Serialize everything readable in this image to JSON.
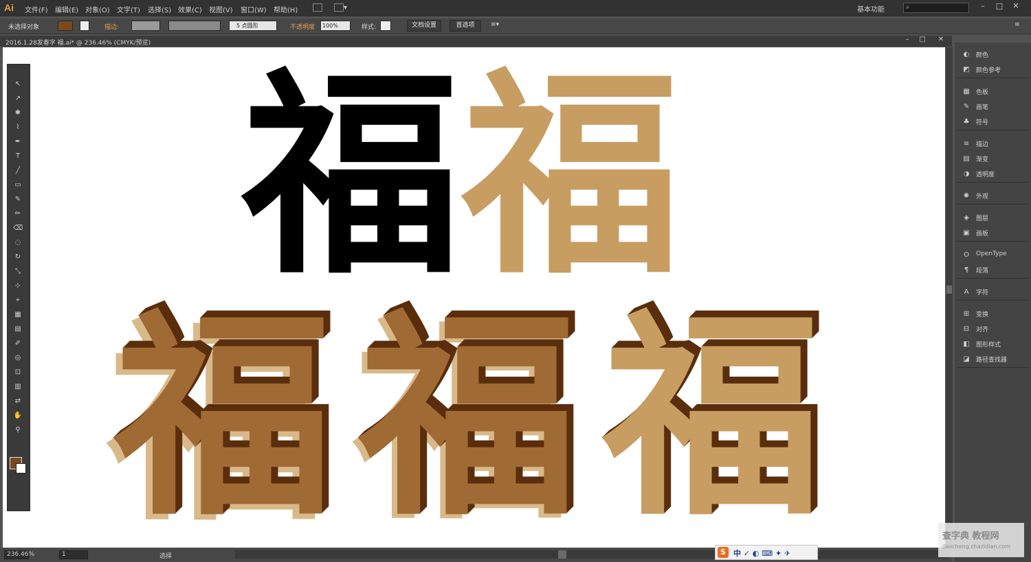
{
  "app": {
    "logo": "Ai",
    "workspace": "基本功能"
  },
  "menu": [
    "文件(F)",
    "编辑(E)",
    "对象(O)",
    "文字(T)",
    "选择(S)",
    "效果(C)",
    "视图(V)",
    "窗口(W)",
    "帮助(H)"
  ],
  "control_bar": {
    "selection_status": "未选择对象",
    "stroke_label": "描边:",
    "brush_value": "5 点圆形",
    "opacity_label": "不透明度",
    "opacity_value": "100%",
    "style_label": "样式:",
    "doc_setup_button": "文档设置",
    "preferences_button": "首选项"
  },
  "document": {
    "tab_title": "2016.1.28发春字 福.ai* @ 236.46% (CMYK/预览)"
  },
  "artwork": {
    "glyph": "福",
    "colors": {
      "black": "#000000",
      "tan": "#c89d62",
      "brown": "#a06a34",
      "dark_brown": "#5a2e0c",
      "light_tan": "#d9b98a"
    }
  },
  "right_panel": {
    "groups": [
      [
        {
          "icon": "color-icon",
          "label": "颜色"
        },
        {
          "icon": "color-guide-icon",
          "label": "颜色参考"
        }
      ],
      [
        {
          "icon": "swatches-icon",
          "label": "色板"
        },
        {
          "icon": "brushes-icon",
          "label": "画笔"
        },
        {
          "icon": "symbols-icon",
          "label": "符号"
        }
      ],
      [
        {
          "icon": "stroke-icon",
          "label": "描边"
        },
        {
          "icon": "gradient-icon",
          "label": "渐变"
        },
        {
          "icon": "transparency-icon",
          "label": "透明度"
        }
      ],
      [
        {
          "icon": "appearance-icon",
          "label": "外观"
        }
      ],
      [
        {
          "icon": "layers-icon",
          "label": "图层"
        },
        {
          "icon": "artboards-icon",
          "label": "画板"
        }
      ],
      [
        {
          "icon": "opentype-icon",
          "label": "OpenType"
        },
        {
          "icon": "paragraph-icon",
          "label": "段落"
        }
      ],
      [
        {
          "icon": "character-icon",
          "label": "字符"
        }
      ],
      [
        {
          "icon": "transform-icon",
          "label": "变换"
        },
        {
          "icon": "align-icon",
          "label": "对齐"
        },
        {
          "icon": "graphic-styles-icon",
          "label": "图形样式"
        },
        {
          "icon": "pathfinder-icon",
          "label": "路径查找器"
        }
      ]
    ]
  },
  "status_bar": {
    "zoom": "236.46%",
    "artboard": "1",
    "status_text": "选择"
  },
  "watermark": {
    "line1": "查字典 教程网",
    "line2": "jiaocheng.chazidian.com"
  }
}
